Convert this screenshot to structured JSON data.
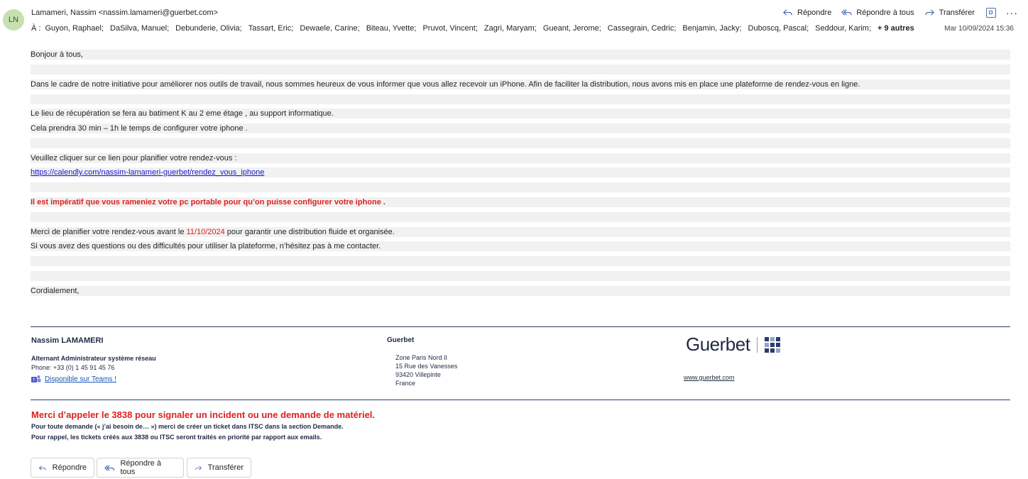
{
  "header": {
    "avatar_initials": "LN",
    "from": "Lamameri, Nassim <nassim.lamameri@guerbet.com>",
    "to_label": "À :",
    "recipients": [
      "Guyon, Raphael;",
      "DaSilva, Manuel;",
      "Debunderie, Olivia;",
      "Tassart, Eric;",
      "Dewaele, Carine;",
      "Biteau, Yvette;",
      "Pruvot, Vincent;",
      "Zagri, Maryam;",
      "Gueant, Jerome;",
      "Cassegrain, Cedric;",
      "Benjamin, Jacky;",
      "Duboscq, Pascal;",
      "Seddour, Karim;"
    ],
    "more_recipients": "+ 9 autres",
    "date": "Mar 10/09/2024 15:36",
    "actions": {
      "reply": "Répondre",
      "reply_all": "Répondre à tous",
      "forward": "Transférer",
      "more": "···"
    },
    "accent_color": "#4a6fb5"
  },
  "body": {
    "greeting": "Bonjour à tous,",
    "p1": "Dans le cadre de notre initiative pour améliorer nos outils de travail, nous sommes heureux de vous informer que vous allez recevoir un iPhone. Afin de faciliter la distribution, nous avons mis en place une plateforme de rendez-vous en ligne.",
    "p2": "Le lieu de récupération se fera au batiment K au 2 eme étage , au support informatique.",
    "p3": "Cela prendra 30 min – 1h le temps de configurer votre iphone .",
    "p4": "Veuillez cliquer sur ce lien pour planifier votre rendez-vous :",
    "link": "https://calendly.com/nassim-lamameri-guerbet/rendez_vous_iphone",
    "warning": "Il est impératif que vous rameniez votre pc portable pour qu’on puisse configurer votre iphone .",
    "p5_before": "Merci de planifier votre rendez-vous avant le ",
    "p5_date": "11/10/2024",
    "p5_after": " pour garantir une distribution fluide et organisée.",
    "p6": "Si vous avez des questions ou des difficultés pour utiliser la plateforme, n’hésitez pas à me contacter.",
    "closing": "Cordialement,"
  },
  "signature": {
    "name": "Nassim LAMAMERI",
    "title": "Alternant Administrateur système réseau",
    "phone": "Phone: +33 (0) 1 45 91 45 76",
    "teams_link": "Disponible sur Teams !",
    "company": "Guerbet",
    "address": [
      "Zone Paris Nord II",
      "15 Rue des Vanesses",
      "93420 Villepinte",
      "France"
    ],
    "logo_text": "Guerbet",
    "website": "www.guerbet.com",
    "notice": "Merci d’appeler le 3838 pour signaler un incident ou une demande de matériel.",
    "note1": "Pour toute demande (« j’ai besoin de… ») merci de créer un ticket dans ITSC dans la section Demande.",
    "note2": "Pour rappel, les tickets créés aux 3838 ou ITSC seront traités en priorité par rapport aux emails."
  },
  "footer_buttons": {
    "reply": "Répondre",
    "reply_all": "Répondre à tous",
    "forward": "Transférer"
  },
  "colors": {
    "warning_red": "#e02020",
    "link_blue": "#1a1acc",
    "signature_navy": "#1f2a44"
  }
}
